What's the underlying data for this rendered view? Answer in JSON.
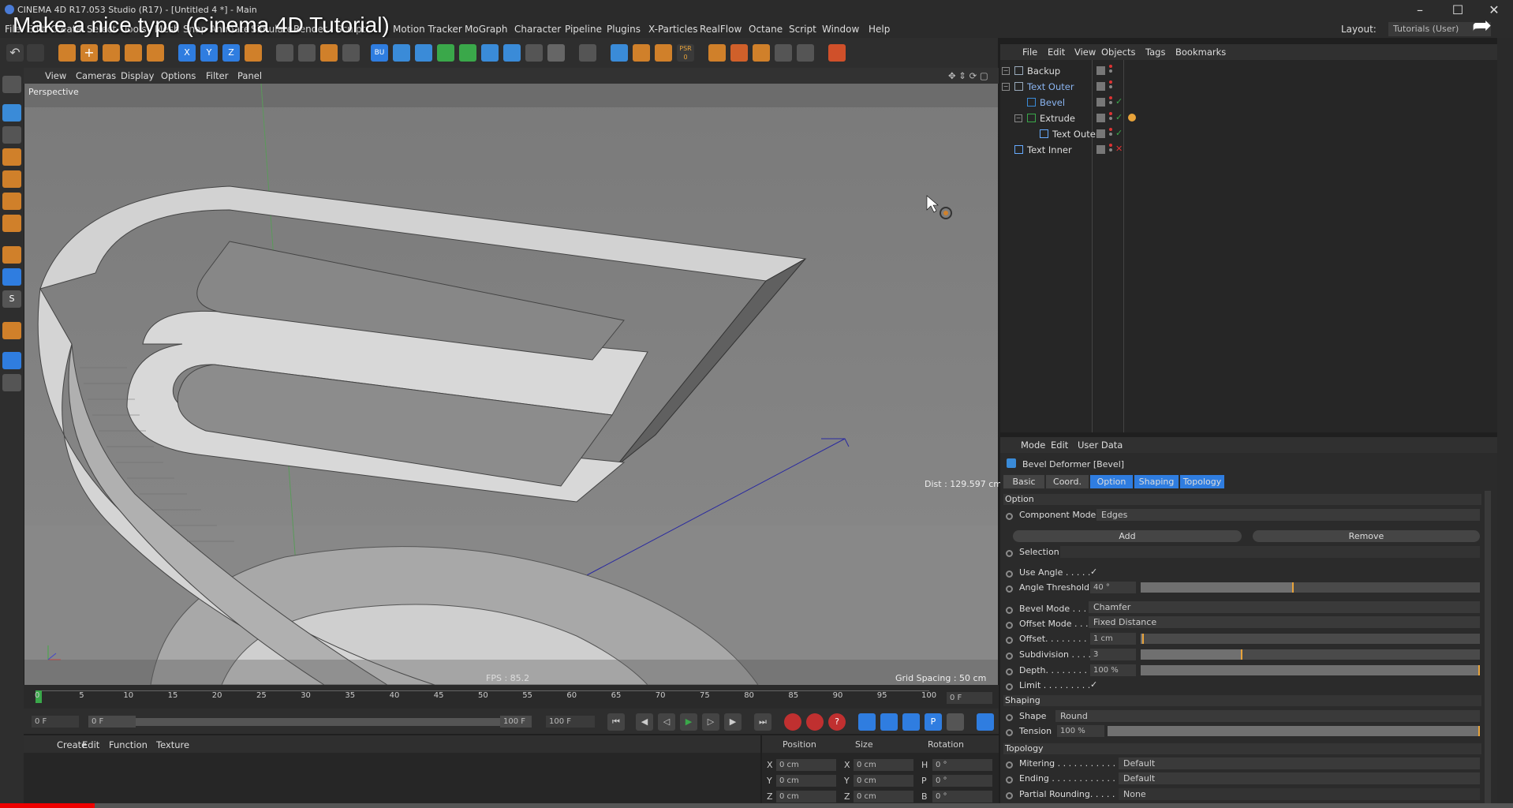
{
  "app_title": "CINEMA 4D R17.053 Studio (R17) - [Untitled 4 *] - Main",
  "video_title": "Make a nice typo (Cinema 4D Tutorial)",
  "window_controls": {
    "minimize": "–",
    "maximize": "☐",
    "close": "✕"
  },
  "menu": [
    "File",
    "Edit",
    "Create",
    "Select",
    "Tools",
    "Mesh",
    "Snap",
    "Animate",
    "Simulate",
    "Render",
    "Sculpt",
    "Motion Tracker",
    "MoGraph",
    "Character",
    "Pipeline",
    "Plugins",
    "X-Particles",
    "RealFlow",
    "Octane",
    "Script",
    "Window",
    "Help"
  ],
  "layout": {
    "label": "Layout:",
    "value": "Tutorials (User)"
  },
  "viewport": {
    "menu": [
      "View",
      "Cameras",
      "Display",
      "Options",
      "Filter",
      "Panel"
    ],
    "camera": "Perspective",
    "dist": "Dist : 129.597 cm",
    "fps": "FPS : 85.2",
    "grid_spacing": "Grid Spacing : 50 cm"
  },
  "timeline": {
    "ticks": [
      "0",
      "5",
      "10",
      "15",
      "20",
      "25",
      "30",
      "35",
      "40",
      "45",
      "50",
      "55",
      "60",
      "65",
      "70",
      "75",
      "80",
      "85",
      "90",
      "95",
      "100"
    ],
    "current_frame": "0 F",
    "start": "0 F",
    "range_start": "0 F",
    "range_end": "100 F",
    "end": "100 F"
  },
  "material_manager": {
    "menu": [
      "Create",
      "Edit",
      "Function",
      "Texture"
    ]
  },
  "coord_manager": {
    "headers": [
      "Position",
      "Size",
      "Rotation"
    ],
    "rows": [
      {
        "axis": "X",
        "pos": "0 cm",
        "size_axis": "X",
        "size": "0 cm",
        "rot_axis": "H",
        "rot": "0 °"
      },
      {
        "axis": "Y",
        "pos": "0 cm",
        "size_axis": "Y",
        "size": "0 cm",
        "rot_axis": "P",
        "rot": "0 °"
      },
      {
        "axis": "Z",
        "pos": "0 cm",
        "size_axis": "Z",
        "size": "0 cm",
        "rot_axis": "B",
        "rot": "0 °"
      }
    ]
  },
  "object_manager": {
    "menu": [
      "File",
      "Edit",
      "View",
      "Objects",
      "Tags",
      "Bookmarks"
    ],
    "objects": [
      {
        "name": "Backup",
        "icon": "null-icon",
        "highlight": false
      },
      {
        "name": "Text Outer",
        "icon": "null-icon",
        "highlight": true
      },
      {
        "name": "Bevel",
        "icon": "bevel-deformer-icon",
        "highlight": true
      },
      {
        "name": "Extrude",
        "icon": "extrude-icon",
        "highlight": false
      },
      {
        "name": "Text Outer",
        "icon": "spline-icon",
        "highlight": false
      },
      {
        "name": "Text Inner",
        "icon": "spline-icon",
        "highlight": false
      }
    ]
  },
  "attribute_manager": {
    "menu": [
      "Mode",
      "Edit",
      "User Data"
    ],
    "object_title": "Bevel Deformer [Bevel]",
    "tabs": [
      "Basic",
      "Coord.",
      "Option",
      "Shaping",
      "Topology"
    ],
    "section_option": "Option",
    "component_mode_label": "Component Mode",
    "component_mode_value": "Edges",
    "add_label": "Add",
    "remove_label": "Remove",
    "selection_label": "Selection",
    "use_angle_label": "Use Angle . . . . .",
    "use_angle_check": "✓",
    "angle_threshold_label": "Angle Threshold",
    "angle_threshold_value": "40 °",
    "angle_threshold_fraction": 0.45,
    "bevel_mode_label": "Bevel Mode . . . .",
    "bevel_mode_value": "Chamfer",
    "offset_mode_label": "Offset Mode . . .",
    "offset_mode_value": "Fixed Distance",
    "offset_label": "Offset. . . . . . . . .",
    "offset_value": "1 cm",
    "offset_fraction": 0.01,
    "subdivision_label": "Subdivision . . . .",
    "subdivision_value": "3",
    "subdivision_fraction": 0.3,
    "depth_label": "Depth. . . . . . . . .",
    "depth_value": "100 %",
    "depth_fraction": 1.0,
    "limit_label": "Limit . . . . . . . . .",
    "limit_check": "✓",
    "section_shaping": "Shaping",
    "shape_label": "Shape",
    "shape_value": "Round",
    "tension_label": "Tension",
    "tension_value": "100 %",
    "tension_fraction": 1.0,
    "section_topology": "Topology",
    "mitering_label": "Mitering . . . . . . . . . . . . . .",
    "mitering_value": "Default",
    "ending_label": "Ending . . . . . . . . . . . . . . .",
    "ending_value": "Default",
    "partial_rounding_label": "Partial Rounding. . . . . . . .",
    "partial_rounding_value": "None"
  },
  "colors": {
    "accent_blue": "#2f7de0",
    "slider_orange": "#e8a33a",
    "youtube_red": "#e00000"
  }
}
